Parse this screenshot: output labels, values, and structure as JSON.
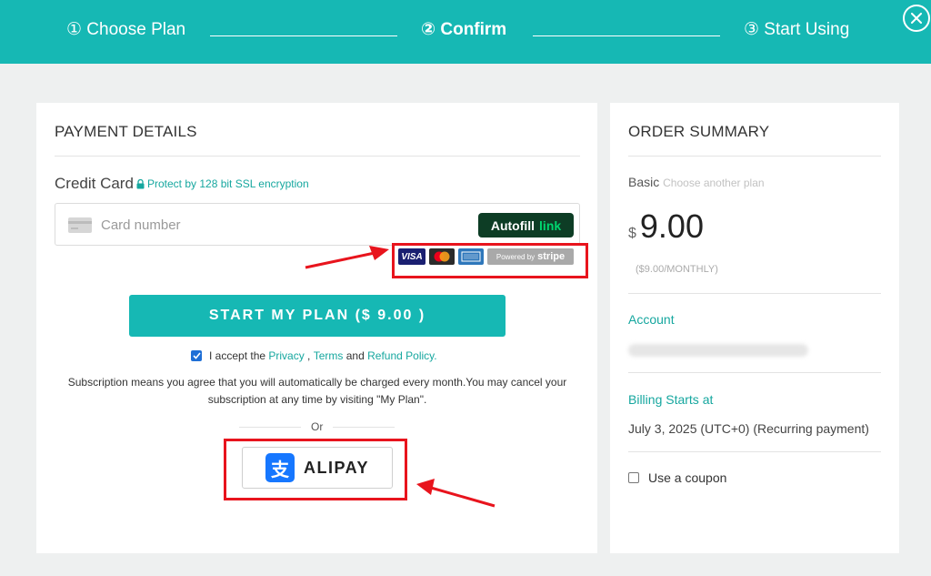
{
  "steps": [
    {
      "label": "① Choose Plan"
    },
    {
      "label": "② Confirm"
    },
    {
      "label": "③ Start Using"
    }
  ],
  "payment": {
    "title": "PAYMENT DETAILS",
    "cc_label": "Credit Card",
    "ssl_note": "Protect by 128 bit SSL encryption",
    "card_placeholder": "Card number",
    "autofill_text": "Autofill",
    "autofill_link": "link",
    "logos": {
      "visa": "VISA",
      "stripe_powered": "Powered by",
      "stripe_name": "stripe"
    },
    "start_button": "START MY PLAN ($ 9.00 )",
    "accept_prefix": "I accept the ",
    "privacy": "Privacy",
    "sep": " , ",
    "terms": "Terms",
    "and": " and ",
    "refund": "Refund Policy.",
    "subscription_note": "Subscription means you agree that you will automatically be charged every month.You may cancel your subscription at any time by visiting \"My Plan\".",
    "or": "Or",
    "alipay_label": "ALIPAY",
    "alipay_glyph": "支"
  },
  "summary": {
    "title": "ORDER SUMMARY",
    "plan_name": "Basic",
    "choose_another": "Choose another plan",
    "currency": "$",
    "amount": "9.00",
    "per_month": "($9.00/MONTHLY)",
    "account_label": "Account",
    "billing_label": "Billing Starts at",
    "billing_date": "July 3, 2025 (UTC+0) (Recurring payment)",
    "coupon_label": "Use a coupon"
  },
  "colors": {
    "accent": "#16b8b4",
    "highlight": "#e8141d",
    "alipay": "#1677ff",
    "link_brand": "#00d66f"
  },
  "icons": [
    "close-icon",
    "lock-icon",
    "credit-card-icon",
    "checkmark-icon",
    "alipay-icon",
    "arrow-icon"
  ]
}
